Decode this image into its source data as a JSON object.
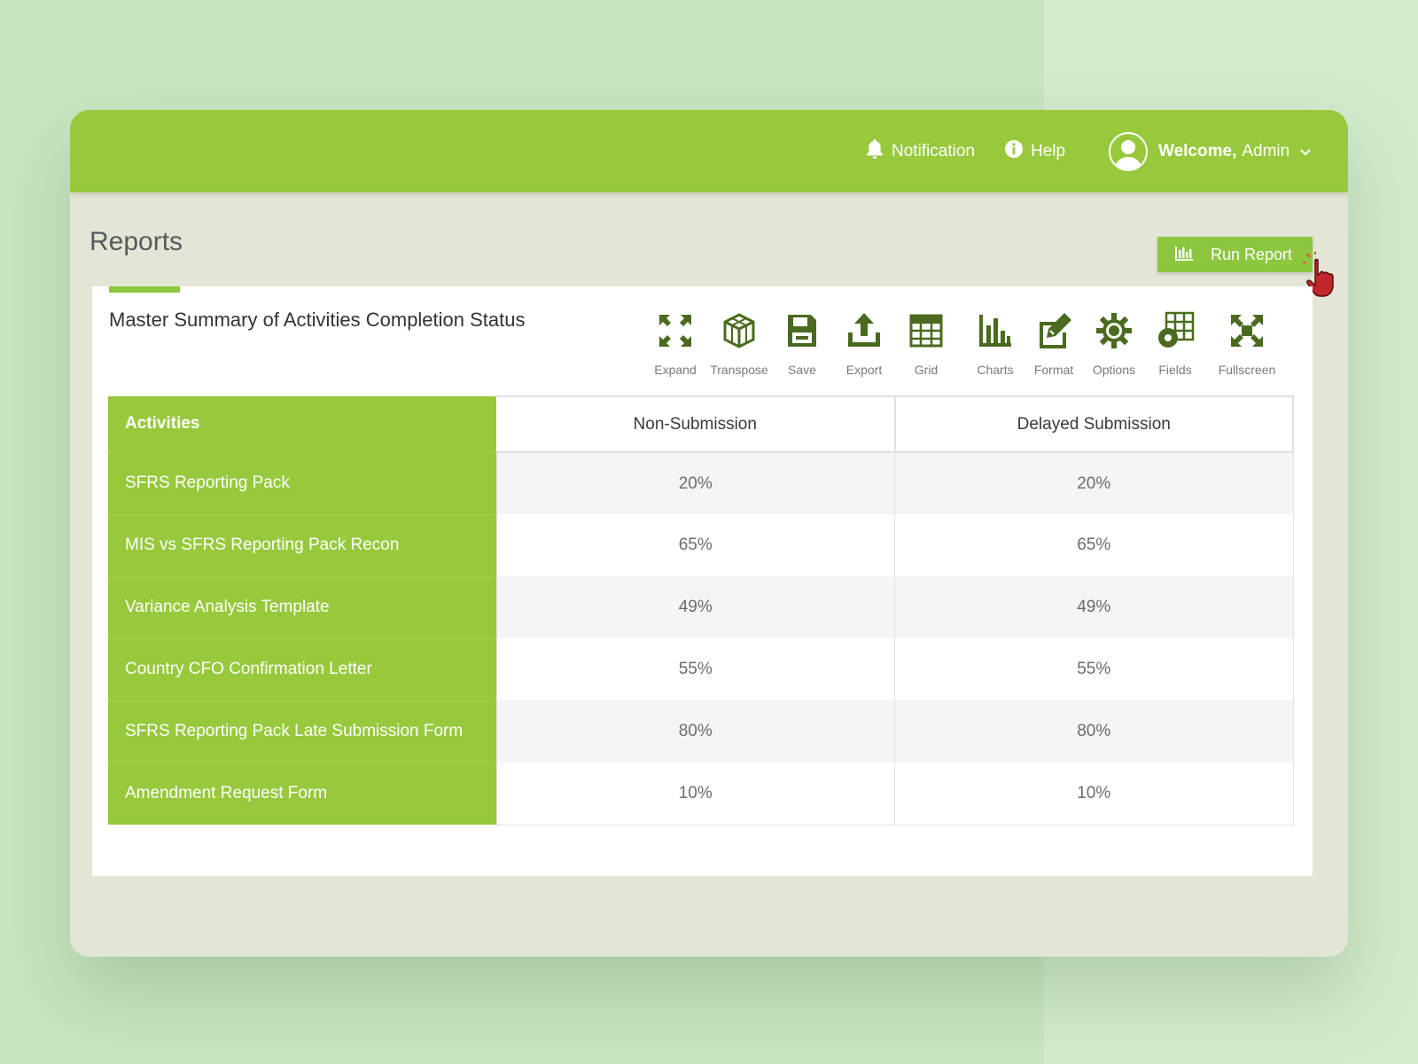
{
  "header": {
    "notification_label": "Notification",
    "help_label": "Help",
    "welcome_label": "Welcome,",
    "user_name": "Admin"
  },
  "page": {
    "title": "Reports",
    "run_report_label": "Run Report"
  },
  "report": {
    "title": "Master Summary of Activities Completion Status",
    "toolbar": [
      {
        "label": "Expand",
        "icon": "expand-icon"
      },
      {
        "label": "Transpose",
        "icon": "cube-icon"
      },
      {
        "label": "Save",
        "icon": "floppy-icon"
      },
      {
        "label": "Export",
        "icon": "upload-icon"
      },
      {
        "label": "Grid",
        "icon": "grid-icon"
      },
      {
        "label": "Charts",
        "icon": "bar-chart-icon"
      },
      {
        "label": "Format",
        "icon": "pencil-icon"
      },
      {
        "label": "Options",
        "icon": "gear-icon"
      },
      {
        "label": "Fields",
        "icon": "fields-icon"
      },
      {
        "label": "Fullscreen",
        "icon": "fullscreen-icon"
      }
    ],
    "columns": [
      "Activities",
      "Non-Submission",
      "Delayed Submission"
    ],
    "rows": [
      {
        "activity": "SFRS Reporting Pack",
        "non_submission": "20%",
        "delayed_submission": "20%"
      },
      {
        "activity": "MIS vs SFRS Reporting Pack Recon",
        "non_submission": "65%",
        "delayed_submission": "65%"
      },
      {
        "activity": "Variance Analysis Template",
        "non_submission": "49%",
        "delayed_submission": "49%"
      },
      {
        "activity": "Country CFO Confirmation Letter",
        "non_submission": "55%",
        "delayed_submission": "55%"
      },
      {
        "activity": "SFRS Reporting Pack Late Submission Form",
        "non_submission": "80%",
        "delayed_submission": "80%"
      },
      {
        "activity": "Amendment Request Form",
        "non_submission": "10%",
        "delayed_submission": "10%"
      }
    ]
  },
  "colors": {
    "accent": "#98c93c",
    "icon": "#4a6b1f",
    "page_bg": "#c9e5c0",
    "window_bg": "#e3e6d6"
  }
}
